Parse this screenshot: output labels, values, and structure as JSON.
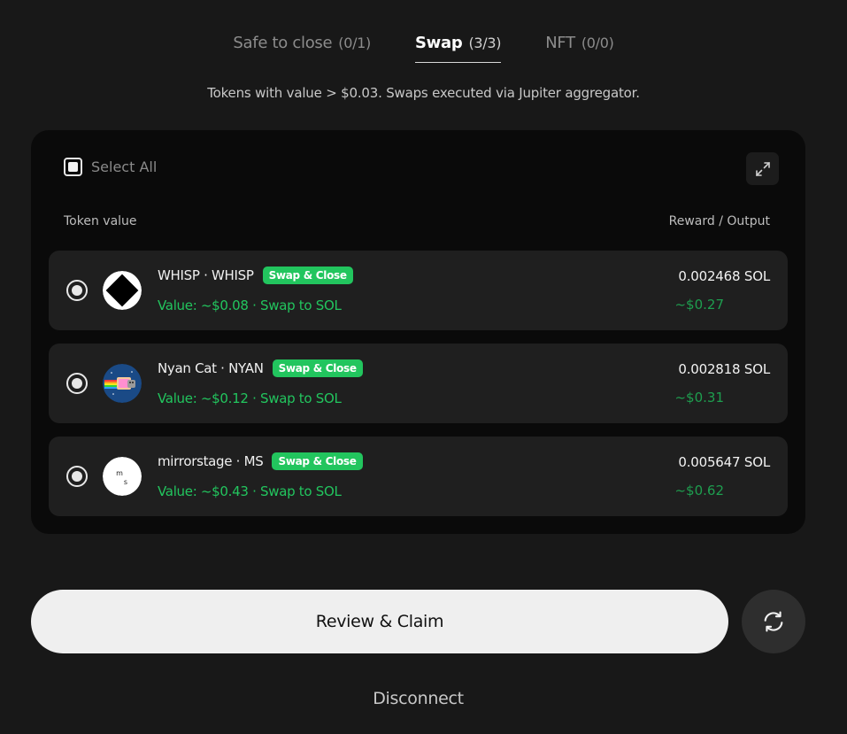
{
  "tabs": [
    {
      "label": "Safe to close",
      "count": "(0/1)",
      "active": false
    },
    {
      "label": "Swap",
      "count": "(3/3)",
      "active": true
    },
    {
      "label": "NFT",
      "count": "(0/0)",
      "active": false
    }
  ],
  "subtitle": "Tokens with value > $0.03. Swaps executed via Jupiter aggregator.",
  "card": {
    "select_all_label": "Select All",
    "col_left": "Token value",
    "col_right": "Reward / Output",
    "rows": [
      {
        "name": "WHISP · WHISP",
        "badge": "Swap & Close",
        "value": "Value: ~$0.08 · Swap to SOL",
        "reward": "0.002468 SOL",
        "reward_usd": "~$0.27",
        "icon": "whisp-logo-icon"
      },
      {
        "name": "Nyan Cat · NYAN",
        "badge": "Swap & Close",
        "value": "Value: ~$0.12 · Swap to SOL",
        "reward": "0.002818 SOL",
        "reward_usd": "~$0.31",
        "icon": "nyan-cat-logo-icon"
      },
      {
        "name": "mirrorstage · MS",
        "badge": "Swap & Close",
        "value": "Value: ~$0.43 · Swap to SOL",
        "reward": "0.005647 SOL",
        "reward_usd": "~$0.62",
        "icon": "mirrorstage-logo-icon",
        "logo_text_1": "m",
        "logo_text_2": "s"
      }
    ]
  },
  "footer": {
    "claim_label": "Review & Claim",
    "disconnect_label": "Disconnect"
  },
  "colors": {
    "background": "#181818",
    "card": "#0a0a0a",
    "row": "#1f1f1f",
    "accent_green": "#22c55e",
    "usd_green": "#1e9e4f"
  }
}
